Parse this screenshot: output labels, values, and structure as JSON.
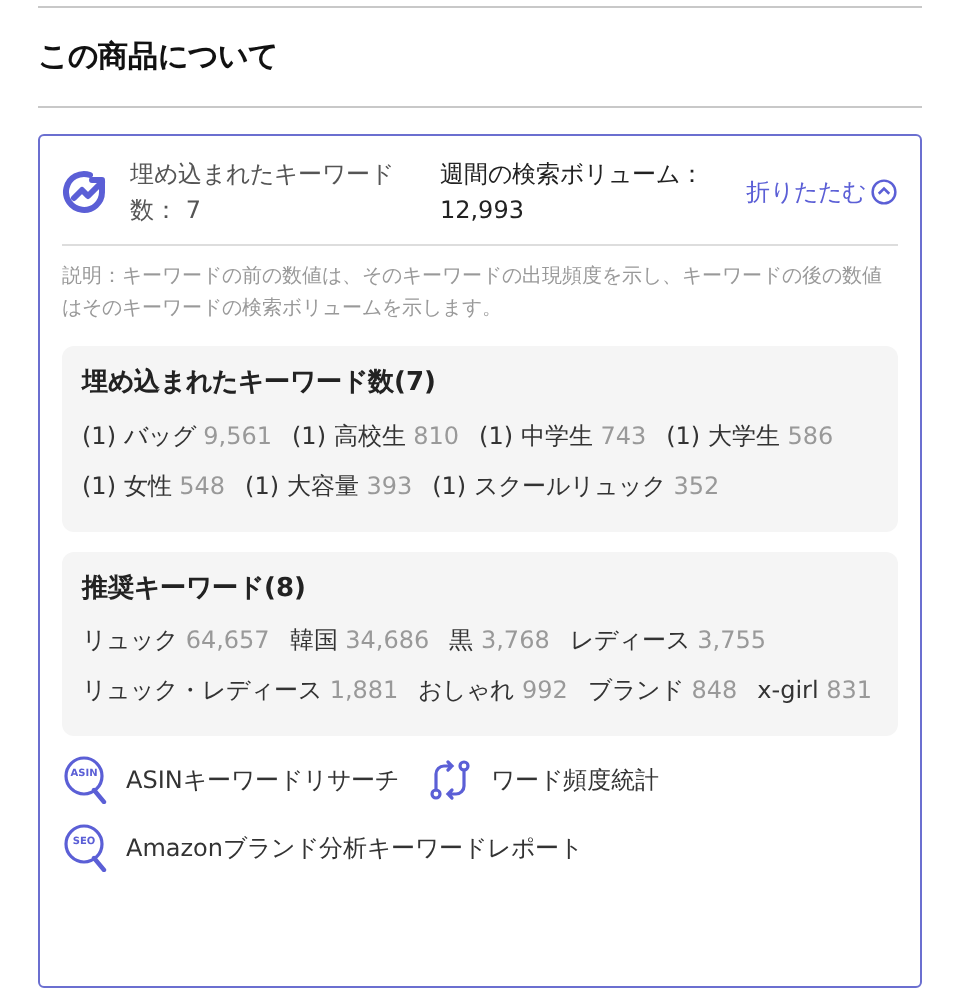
{
  "heading": "この商品について",
  "summary": {
    "embedded_label": "埋め込まれたキーワード数：",
    "embedded_count": "7",
    "volume_label": "週間の検索ボリューム：",
    "volume_value": "12,993",
    "collapse": "折りたたむ",
    "expanded": true
  },
  "note": "説明：キーワードの前の数値は、そのキーワードの出現頻度を示し、キーワードの後の数値はそのキーワードの検索ボリュームを示します。",
  "embedded": {
    "title": "埋め込まれたキーワード数(7)",
    "items": [
      {
        "freq": "(1)",
        "word": "バッグ",
        "volume": "9,561"
      },
      {
        "freq": "(1)",
        "word": "高校生",
        "volume": "810"
      },
      {
        "freq": "(1)",
        "word": "中学生",
        "volume": "743"
      },
      {
        "freq": "(1)",
        "word": "大学生",
        "volume": "586"
      },
      {
        "freq": "(1)",
        "word": "女性",
        "volume": "548"
      },
      {
        "freq": "(1)",
        "word": "大容量",
        "volume": "393"
      },
      {
        "freq": "(1)",
        "word": "スクールリュック",
        "volume": "352"
      }
    ]
  },
  "recommended": {
    "title": "推奨キーワード(8)",
    "items": [
      {
        "word": "リュック",
        "volume": "64,657"
      },
      {
        "word": "韓国",
        "volume": "34,686"
      },
      {
        "word": "黒",
        "volume": "3,768"
      },
      {
        "word": "レディース",
        "volume": "3,755"
      },
      {
        "word": "リュック・レディース",
        "volume": "1,881"
      },
      {
        "word": "おしゃれ",
        "volume": "992"
      },
      {
        "word": "ブランド",
        "volume": "848"
      },
      {
        "word": "x-girl",
        "volume": "831"
      }
    ]
  },
  "tools": [
    {
      "kind": "badge",
      "badge": "ASIN",
      "label": "ASINキーワードリサーチ"
    },
    {
      "kind": "cycle",
      "label": "ワード頻度統計"
    },
    {
      "kind": "badge",
      "badge": "SEO",
      "label": "Amazonブランド分析キーワードレポート"
    }
  ]
}
